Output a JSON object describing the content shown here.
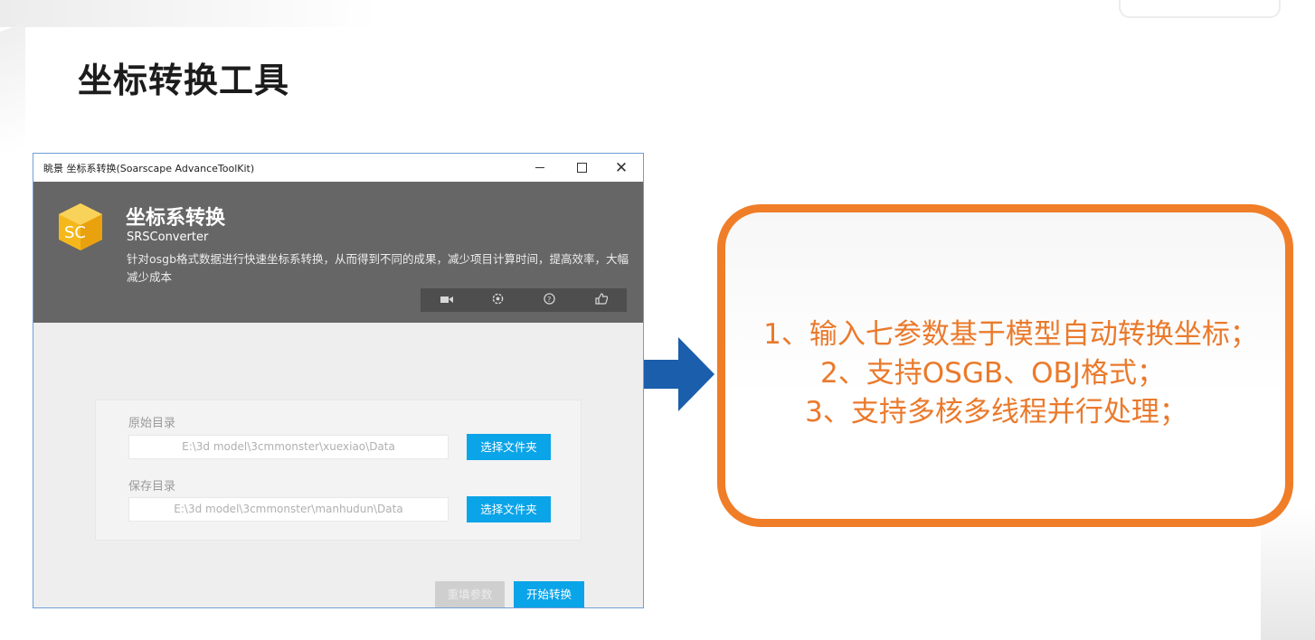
{
  "slide": {
    "title": "坐标转换工具"
  },
  "window": {
    "title": "眺景 坐标系转换(Soarscape AdvanceToolKit)",
    "controls": {
      "minimize": "minimize",
      "maximize": "maximize",
      "close": "✕"
    }
  },
  "app": {
    "logo_text": "SC",
    "title": "坐标系转换",
    "subtitle": "SRSConverter",
    "description": "针对osgb格式数据进行快速坐标系转换，从而得到不同的成果，减少项目计算时间，提高效率，大幅减少成本",
    "toolbar_icons": [
      "video-icon",
      "settings-icon",
      "help-icon",
      "like-icon"
    ]
  },
  "form": {
    "source_label": "原始目录",
    "source_value": "E:\\3d model\\3cmmonster\\xuexiao\\Data",
    "source_button": "选择文件夹",
    "save_label": "保存目录",
    "save_value": "E:\\3d model\\3cmmonster\\manhudun\\Data",
    "save_button": "选择文件夹",
    "reset_button": "重填参数",
    "start_button": "开始转换"
  },
  "features": {
    "line1": "1、输入七参数基于模型自动转换坐标；",
    "line2": "2、支持OSGB、OBJ格式；",
    "line3": "3、支持多核多线程并行处理；"
  },
  "colors": {
    "accent_orange": "#f07d28",
    "feature_text": "#ea7a2c",
    "button_blue": "#0aa4e8",
    "arrow_blue": "#1a5eac",
    "header_gray": "#666666",
    "logo_yellow": "#f5b81c"
  }
}
